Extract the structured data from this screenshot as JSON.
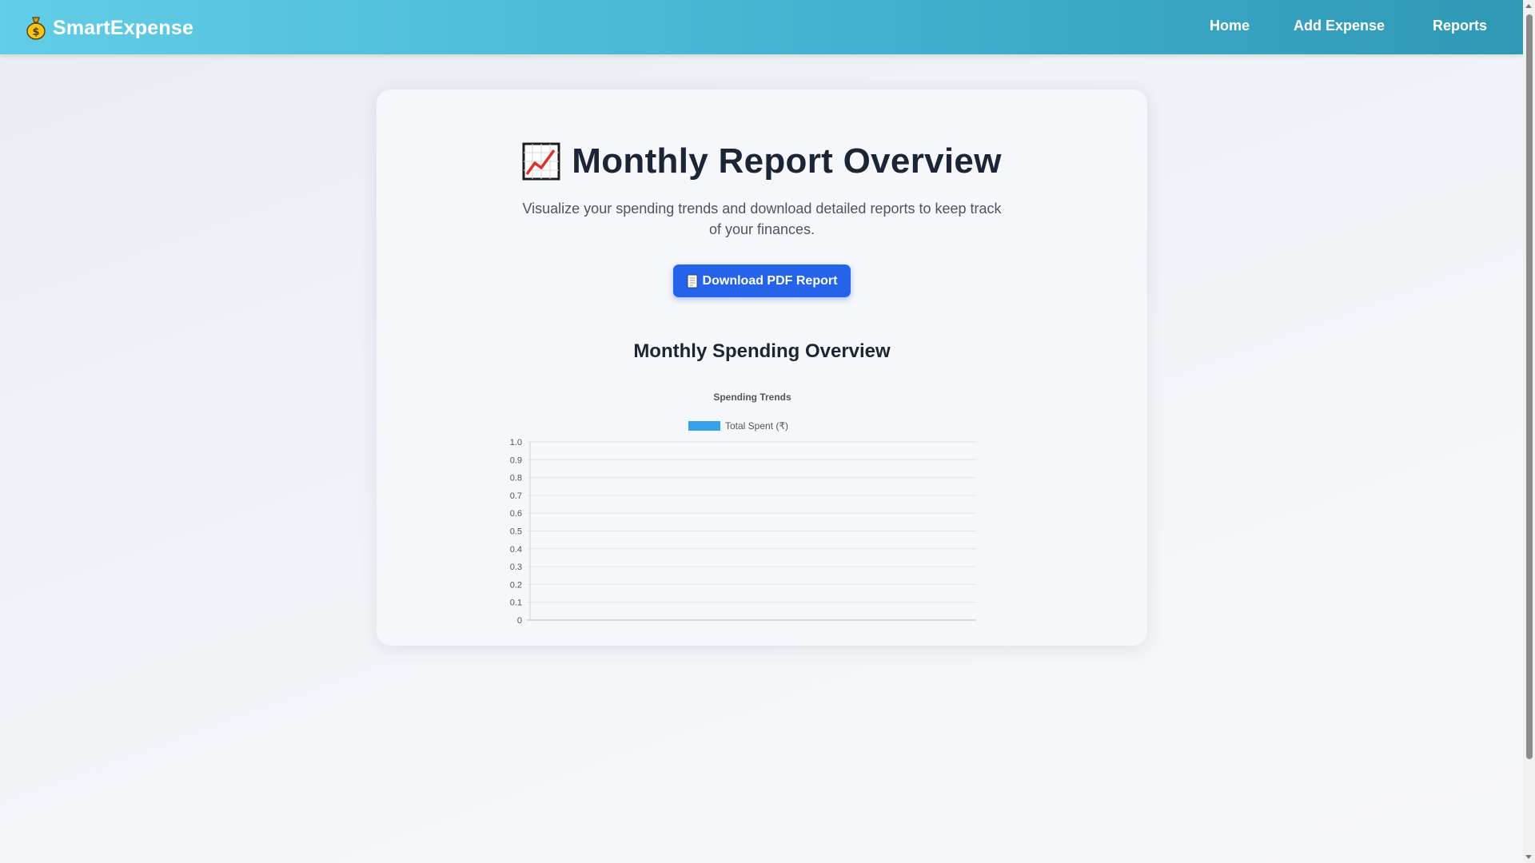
{
  "navbar": {
    "brand": "SmartExpense",
    "brand_icon": "money-bag-icon",
    "links": [
      "Home",
      "Add Expense",
      "Reports"
    ]
  },
  "report": {
    "title": "Monthly Report Overview",
    "title_icon": "chart-increasing-icon",
    "subtitle": "Visualize your spending trends and download detailed reports to keep track of your finances.",
    "download_label": "Download PDF Report",
    "download_icon": "page-icon",
    "section_title": "Monthly Spending Overview"
  },
  "colors": {
    "navbar_start": "#62cde6",
    "navbar_end": "#2f98b5",
    "button": "#2563eb",
    "series": "#36a2eb"
  },
  "chart_data": {
    "type": "bar",
    "title": "Spending Trends",
    "categories": [],
    "series": [
      {
        "name": "Total Spent (₹)",
        "values": []
      }
    ],
    "yticks": [
      "0",
      "0.1",
      "0.2",
      "0.3",
      "0.4",
      "0.5",
      "0.6",
      "0.7",
      "0.8",
      "0.9",
      "1.0"
    ],
    "ylim": [
      0,
      1
    ],
    "grid": true,
    "legend": "top"
  }
}
